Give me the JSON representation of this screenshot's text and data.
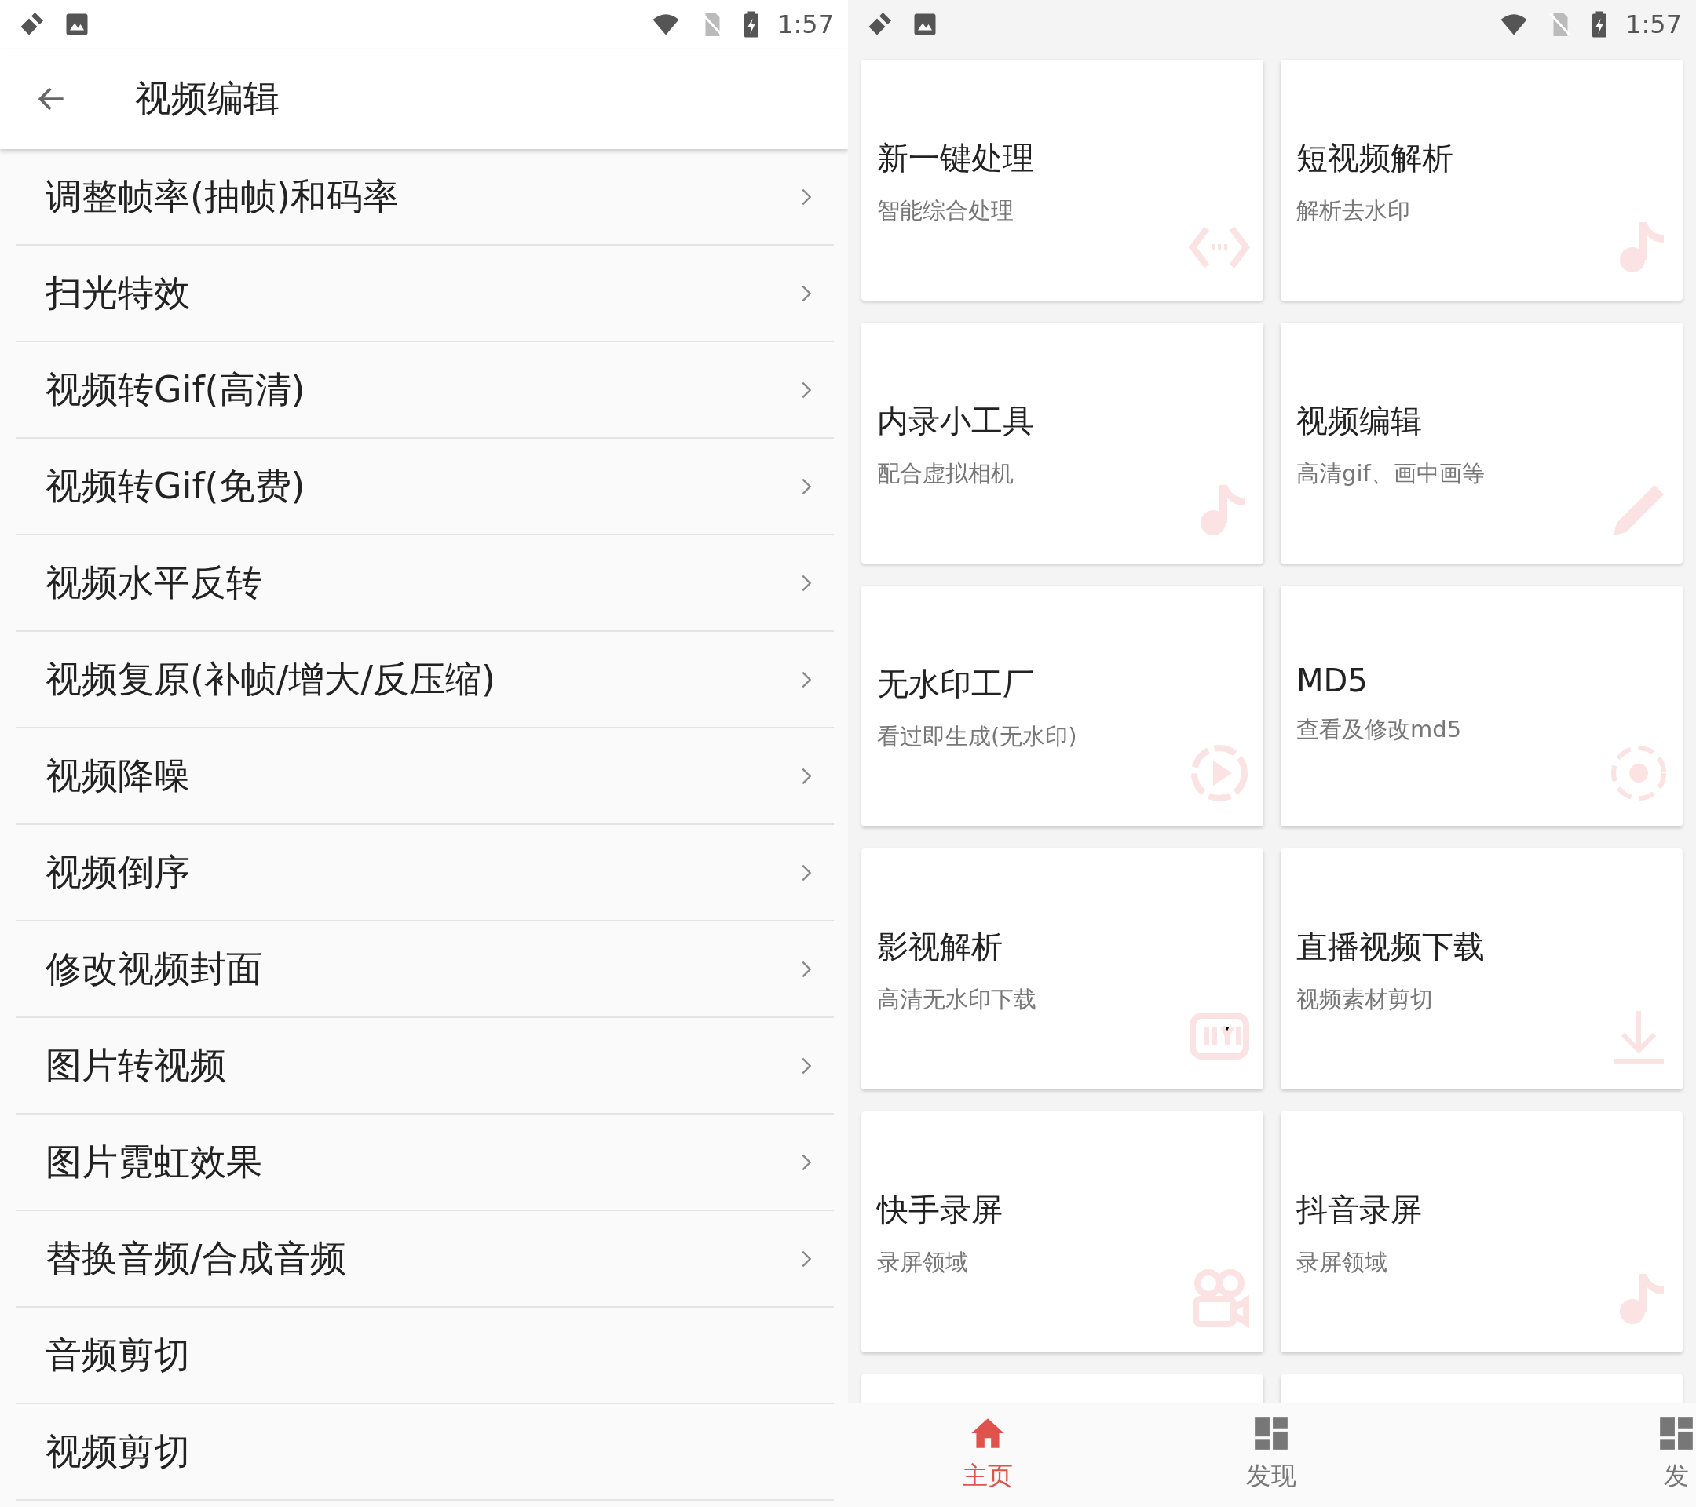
{
  "left_screen": {
    "status_bar": {
      "time": "1:57"
    },
    "app_bar": {
      "title": "视频编辑"
    },
    "menu_items": [
      {
        "label": "调整帧率(抽帧)和码率",
        "chevron": true
      },
      {
        "label": "扫光特效",
        "chevron": true
      },
      {
        "label": "视频转Gif(高清)",
        "chevron": true
      },
      {
        "label": "视频转Gif(免费)",
        "chevron": true
      },
      {
        "label": "视频水平反转",
        "chevron": true
      },
      {
        "label": "视频复原(补帧/增大/反压缩)",
        "chevron": true
      },
      {
        "label": "视频降噪",
        "chevron": true
      },
      {
        "label": "视频倒序",
        "chevron": true
      },
      {
        "label": "修改视频封面",
        "chevron": true
      },
      {
        "label": "图片转视频",
        "chevron": true
      },
      {
        "label": "图片霓虹效果",
        "chevron": true
      },
      {
        "label": "替换音频/合成音频",
        "chevron": true
      },
      {
        "label": "音频剪切",
        "chevron": false
      },
      {
        "label": "视频剪切",
        "chevron": false
      }
    ]
  },
  "right_screen": {
    "status_bar": {
      "time": "1:57"
    },
    "cards": [
      {
        "title": "新一键处理",
        "subtitle": "智能综合处理"
      },
      {
        "title": "短视频解析",
        "subtitle": "解析去水印"
      },
      {
        "title": "内录小工具",
        "subtitle": "配合虚拟相机"
      },
      {
        "title": "视频编辑",
        "subtitle": "高清gif、画中画等"
      },
      {
        "title": "无水印工厂",
        "subtitle": "看过即生成(无水印)"
      },
      {
        "title": "MD5",
        "subtitle": "查看及修改md5"
      },
      {
        "title": "影视解析",
        "subtitle": "高清无水印下载"
      },
      {
        "title": "直播视频下载",
        "subtitle": "视频素材剪切"
      },
      {
        "title": "快手录屏",
        "subtitle": "录屏领域"
      },
      {
        "title": "抖音录屏",
        "subtitle": "录屏领域"
      }
    ],
    "bottom_nav": [
      {
        "label": "主页",
        "selected": true
      },
      {
        "label": "发现",
        "selected": false
      },
      {
        "label": "发",
        "selected": false
      }
    ]
  }
}
